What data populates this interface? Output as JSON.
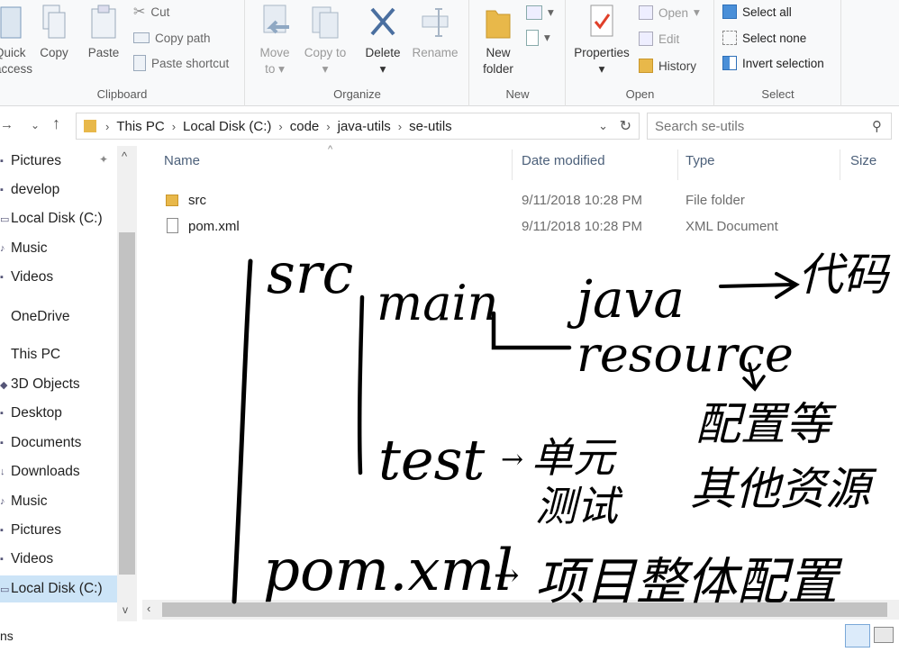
{
  "ribbon": {
    "clipboard": {
      "label": "Clipboard",
      "quick_access": "Quick\naccess",
      "copy": "Copy",
      "paste": "Paste",
      "cut": "Cut",
      "copy_path": "Copy path",
      "paste_shortcut": "Paste shortcut"
    },
    "organize": {
      "label": "Organize",
      "move_to": "Move to",
      "copy_to": "Copy to",
      "delete": "Delete",
      "rename": "Rename"
    },
    "new": {
      "label": "New",
      "new_folder": "New folder"
    },
    "open": {
      "label": "Open",
      "properties": "Properties",
      "open": "Open",
      "edit": "Edit",
      "history": "History"
    },
    "select": {
      "label": "Select",
      "select_all": "Select all",
      "select_none": "Select none",
      "invert_selection": "Invert selection"
    }
  },
  "address": {
    "crumbs": [
      "This PC",
      "Local Disk (C:)",
      "code",
      "java-utils",
      "se-utils"
    ],
    "search_placeholder": "Search se-utils"
  },
  "nav": {
    "items": [
      {
        "label": "Pictures",
        "icon": "pictures-icon"
      },
      {
        "label": "develop",
        "icon": "folder-icon"
      },
      {
        "label": "Local Disk (C:)",
        "icon": "drive-icon"
      },
      {
        "label": "Music",
        "icon": "music-icon"
      },
      {
        "label": "Videos",
        "icon": "videos-icon"
      },
      {
        "label": "OneDrive",
        "icon": "onedrive-icon"
      },
      {
        "label": "This PC",
        "icon": "pc-icon"
      },
      {
        "label": "3D Objects",
        "icon": "3d-objects-icon"
      },
      {
        "label": "Desktop",
        "icon": "desktop-icon"
      },
      {
        "label": "Documents",
        "icon": "documents-icon"
      },
      {
        "label": "Downloads",
        "icon": "downloads-icon"
      },
      {
        "label": "Music",
        "icon": "music-icon"
      },
      {
        "label": "Pictures",
        "icon": "pictures-icon"
      },
      {
        "label": "Videos",
        "icon": "videos-icon"
      },
      {
        "label": "Local Disk (C:)",
        "icon": "drive-icon"
      }
    ]
  },
  "list": {
    "columns": [
      "Name",
      "Date modified",
      "Type",
      "Size"
    ],
    "rows": [
      {
        "name": "src",
        "date": "9/11/2018 10:28 PM",
        "type": "File folder",
        "icon": "folder-icon"
      },
      {
        "name": "pom.xml",
        "date": "9/11/2018 10:28 PM",
        "type": "XML Document",
        "icon": "xml-file-icon"
      }
    ]
  },
  "status": {
    "items_text": "ns"
  },
  "annotation": {
    "src": "src",
    "main": "main",
    "java": "java",
    "code": "代码",
    "resource": "resource",
    "config": "配置等",
    "other_res": "其他资源",
    "test": "test",
    "unit": "单元",
    "testing": "测试",
    "pom": "pom.xml",
    "project_config": "项目整体配置"
  },
  "colors": {
    "folder": "#e8b84a",
    "selection": "#cce4f7",
    "header_text": "#4c607a",
    "ink": "#000000"
  }
}
